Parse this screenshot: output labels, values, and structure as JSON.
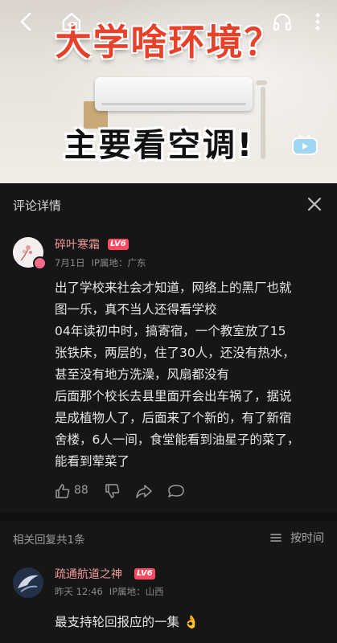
{
  "video": {
    "title": "大学啥环境？",
    "subtitle": "主要看空调!"
  },
  "top_bar": {
    "back_icon": "back-arrow-icon",
    "home_icon": "home-icon",
    "listen_icon": "headphones-icon",
    "more_icon": "more-vertical-icon"
  },
  "comment_panel": {
    "title": "评论详情",
    "close_icon": "close-icon",
    "main_comment": {
      "username": "碎叶寒霜",
      "level": "LV6",
      "date": "7月1日",
      "ip_location": "IP属地：广东",
      "lines": [
        "出了学校来社会才知道，网络上的黑厂也就",
        "图一乐，真不当人还得看学校",
        "04年读初中时，搞寄宿，一个教室放了15",
        "张铁床，两层的，住了30人，还没有热水，",
        "甚至没有地方洗澡，风扇都没有",
        "后面那个校长去县里面开会出车祸了，据说",
        "是成植物人了，后面来了个新的，有了新宿",
        "舍楼，6人一间，食堂能看到油星子的菜了，",
        "能看到荤菜了"
      ],
      "like_count": "88"
    },
    "replies": {
      "count_label": "相关回复共1条",
      "sort_label": "按时间",
      "items": [
        {
          "username": "疏通航道之神",
          "level": "LV6",
          "time": "昨天 12:46",
          "ip_location": "IP属地：山西",
          "text": "最支持轮回报应的一集",
          "emoji": "👌"
        }
      ]
    }
  },
  "colors": {
    "background": "#161616",
    "username": "#f29a9a",
    "level_badge": "#ff4a62",
    "title_red": "#e8412b"
  }
}
